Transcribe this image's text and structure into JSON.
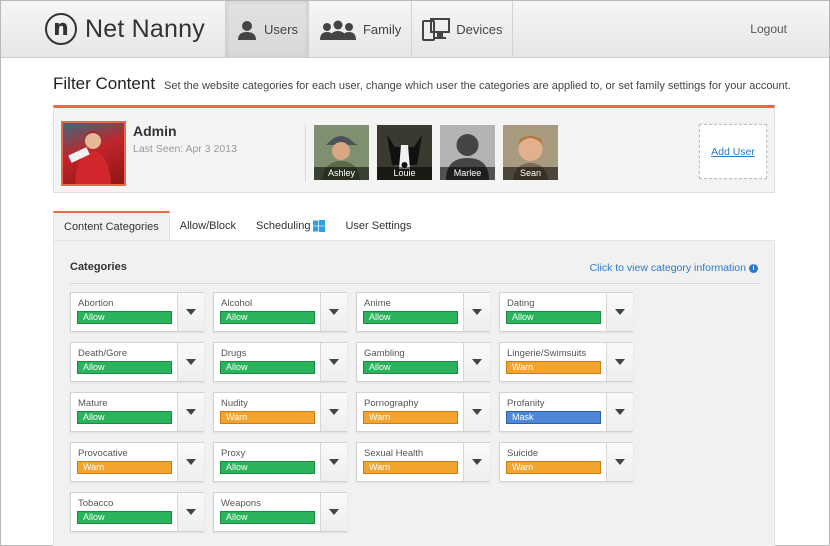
{
  "header": {
    "logo_text": "Net Nanny",
    "nav": [
      {
        "label": "Users",
        "icon": "user-icon",
        "active": true
      },
      {
        "label": "Family",
        "icon": "family-icon",
        "active": false
      },
      {
        "label": "Devices",
        "icon": "devices-icon",
        "active": false
      }
    ],
    "logout_label": "Logout"
  },
  "page": {
    "title": "Filter Content",
    "subtitle": "Set the website categories for each user, change which user the categories are applied to, or set family settings for your account."
  },
  "admin": {
    "name": "Admin",
    "last_seen": "Last Seen: Apr 3 2013"
  },
  "family_members": [
    {
      "name": "Ashley"
    },
    {
      "name": "Louie"
    },
    {
      "name": "Marlee"
    },
    {
      "name": "Sean"
    }
  ],
  "add_user_label": "Add User",
  "tabs": [
    {
      "label": "Content Categories",
      "active": true
    },
    {
      "label": "Allow/Block",
      "active": false
    },
    {
      "label": "Scheduling",
      "active": false
    },
    {
      "label": "User Settings",
      "active": false
    }
  ],
  "categories_section": {
    "heading": "Categories",
    "info_link": "Click to view category information",
    "items": [
      {
        "name": "Abortion",
        "status": "Allow",
        "type": "allow"
      },
      {
        "name": "Alcohol",
        "status": "Allow",
        "type": "allow"
      },
      {
        "name": "Anime",
        "status": "Allow",
        "type": "allow"
      },
      {
        "name": "Dating",
        "status": "Allow",
        "type": "allow"
      },
      {
        "name": "Death/Gore",
        "status": "Allow",
        "type": "allow"
      },
      {
        "name": "Drugs",
        "status": "Allow",
        "type": "allow"
      },
      {
        "name": "Gambling",
        "status": "Allow",
        "type": "allow"
      },
      {
        "name": "Lingerie/Swimsuits",
        "status": "Warn",
        "type": "warn"
      },
      {
        "name": "Mature",
        "status": "Allow",
        "type": "allow"
      },
      {
        "name": "Nudity",
        "status": "Warn",
        "type": "warn"
      },
      {
        "name": "Pornography",
        "status": "Warn",
        "type": "warn"
      },
      {
        "name": "Profanity",
        "status": "Mask",
        "type": "mask"
      },
      {
        "name": "Provocative",
        "status": "Warn",
        "type": "warn"
      },
      {
        "name": "Proxy",
        "status": "Allow",
        "type": "allow"
      },
      {
        "name": "Sexual Health",
        "status": "Warn",
        "type": "warn"
      },
      {
        "name": "Suicide",
        "status": "Warn",
        "type": "warn"
      },
      {
        "name": "Tobacco",
        "status": "Allow",
        "type": "allow"
      },
      {
        "name": "Weapons",
        "status": "Allow",
        "type": "allow"
      }
    ]
  },
  "colors": {
    "accent": "#e8684a",
    "allow": "#29b35a",
    "warn": "#f3a42f",
    "mask": "#4f87d8",
    "link": "#2b7ac8"
  }
}
